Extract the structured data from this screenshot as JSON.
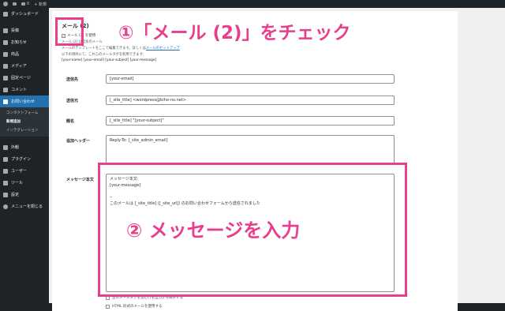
{
  "admin_bar": {
    "comments_count": "0",
    "new_label": "+ 新規"
  },
  "sidebar": {
    "items": [
      {
        "label": "ダッシュボード",
        "icon": "dashboard-icon"
      },
      {
        "label": "投稿",
        "icon": "pin-icon"
      },
      {
        "label": "お知らせ",
        "icon": "pin-icon"
      },
      {
        "label": "商品",
        "icon": "pin-icon"
      },
      {
        "label": "メディア",
        "icon": "media-icon"
      },
      {
        "label": "固定ページ",
        "icon": "page-icon"
      },
      {
        "label": "コメント",
        "icon": "comment-icon"
      },
      {
        "label": "お問い合わせ",
        "icon": "mail-icon",
        "active": true
      },
      {
        "label": "外観",
        "icon": "brush-icon"
      },
      {
        "label": "プラグイン",
        "icon": "plugin-icon"
      },
      {
        "label": "ユーザー",
        "icon": "user-icon"
      },
      {
        "label": "ツール",
        "icon": "wrench-icon"
      },
      {
        "label": "設定",
        "icon": "settings-icon"
      },
      {
        "label": "メニューを閉じる",
        "icon": "collapse-icon"
      }
    ],
    "submenu": [
      {
        "label": "コンタクトフォーム"
      },
      {
        "label": "新規追加",
        "current": true
      },
      {
        "label": "インテグレーション"
      }
    ]
  },
  "form": {
    "heading": "メール (2)",
    "use_mail2_label": "メール (2) を使用",
    "note_line1": "メール (2) は追加のメール",
    "note_line2": "メールのテンプレートをここで編集できます。詳しくは",
    "note_link": "メールのセットアップ",
    "note_line3": "以下の項目にて、これらのメールタグを利用できます:",
    "mail_tags": "[your-name] [your-email] [your-subject] [your-message]",
    "fields": {
      "to_label": "送信先",
      "to_value": "[your-email]",
      "from_label": "送信元",
      "from_value": "[_site_title] <wordpress@biho-no.net>",
      "subject_label": "題名",
      "subject_value": "[_site_title] \"[your-subject]\"",
      "headers_label": "追加ヘッダー",
      "headers_value": "Reply-To: [_site_admin_email]",
      "body_label": "メッセージ本文",
      "body_value": "メッセージ本文:\n[your-message]\n\n--\nこのメールは [_site_title] ([_site_url]) のお問い合わせフォームから送信されました"
    },
    "option1": "空のメールタグを含む行を出力から除外する",
    "option2": "HTML 形式のメールを使用する"
  },
  "annotations": {
    "step1": "①「メール (2)」をチェック",
    "step2": "② メッセージを入力",
    "highlight_color": "#e83e8c"
  }
}
